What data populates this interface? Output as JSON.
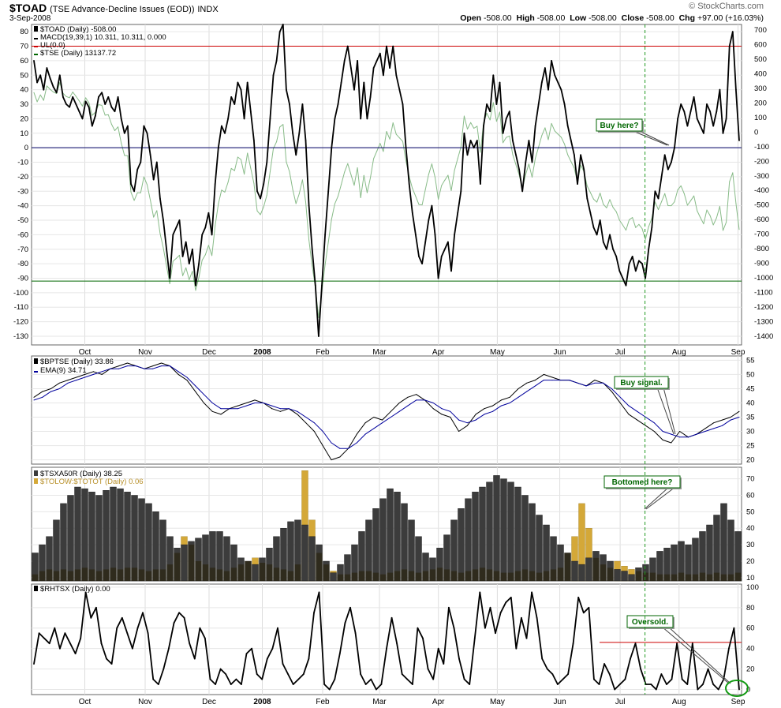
{
  "header": {
    "symbol": "$TOAD",
    "description": "(TSE Advance-Decline Issues (EOD))",
    "exchange": "INDX",
    "date": "3-Sep-2008",
    "open_label": "Open",
    "open_value": "-508.00",
    "high_label": "High",
    "high_value": "-508.00",
    "low_label": "Low",
    "low_value": "-508.00",
    "close_label": "Close",
    "close_value": "-508.00",
    "chg_label": "Chg",
    "chg_value": "+97.00 (+16.03%)",
    "logo": "© StockCharts.com"
  },
  "colors": {
    "black": "#000000",
    "red": "#cc0000",
    "navy": "#000066",
    "green": "#006600",
    "light_green": "#88bb88",
    "blue": "#00009c",
    "gold": "#d4a838",
    "dark_bar": "#3c3c3c"
  },
  "x_axis": {
    "months": [
      "Oct",
      "Nov",
      "Dec",
      "2008",
      "Feb",
      "Mar",
      "Apr",
      "May",
      "Jun",
      "Jul",
      "Aug",
      "Sep"
    ]
  },
  "chart_data": [
    {
      "type": "line",
      "panel": "top",
      "legend": [
        "$TOAD (Daily) -508.00",
        "MACD(19,39,1) 10.311, 10.311, 0.000",
        "UL(0.0)",
        "$TSE (Daily) 13137.72"
      ],
      "series_names": [
        "$TOAD",
        "$TSE"
      ],
      "left_axis": {
        "min": -130,
        "max": 80,
        "ticks": [
          80,
          70,
          60,
          50,
          40,
          30,
          20,
          10,
          0,
          -10,
          -20,
          -30,
          -40,
          -50,
          -60,
          -70,
          -80,
          -90,
          -100,
          -110,
          -120,
          -130
        ]
      },
      "right_axis": {
        "ticks": [
          700,
          600,
          500,
          400,
          300,
          200,
          100,
          0,
          -100,
          -200,
          -300,
          -400,
          -500,
          -600,
          -700,
          -800,
          -900,
          -1000,
          -1100,
          -1200,
          -1300,
          -1400
        ]
      },
      "hlines": [
        70,
        0,
        -92
      ],
      "annotation": "Buy here?",
      "macd": [
        60,
        45,
        50,
        40,
        55,
        48,
        42,
        38,
        50,
        35,
        30,
        28,
        35,
        30,
        25,
        20,
        32,
        28,
        15,
        22,
        35,
        38,
        30,
        35,
        28,
        25,
        35,
        20,
        10,
        15,
        -25,
        -30,
        -15,
        -10,
        15,
        10,
        -5,
        -22,
        -10,
        -35,
        -50,
        -70,
        -90,
        -60,
        -55,
        -50,
        -75,
        -65,
        -80,
        -70,
        -95,
        -80,
        -60,
        -55,
        -45,
        -60,
        -25,
        0,
        15,
        10,
        20,
        35,
        30,
        45,
        40,
        20,
        45,
        25,
        5,
        -30,
        -35,
        -25,
        -10,
        20,
        50,
        60,
        80,
        85,
        40,
        30,
        10,
        -5,
        10,
        30,
        5,
        -40,
        -70,
        -95,
        -130,
        -95,
        -60,
        -30,
        0,
        20,
        30,
        45,
        60,
        70,
        55,
        40,
        60,
        20,
        45,
        20,
        35,
        55,
        60,
        65,
        50,
        70,
        55,
        70,
        50,
        40,
        30,
        0,
        -25,
        -45,
        -60,
        -75,
        -80,
        -65,
        -50,
        -40,
        -60,
        -90,
        -75,
        -70,
        -65,
        -85,
        -60,
        -45,
        -30,
        10,
        -5,
        5,
        0,
        5,
        -25,
        15,
        30,
        25,
        50,
        30,
        45,
        10,
        20,
        25,
        5,
        -5,
        -15,
        -30,
        -10,
        5,
        -10,
        15,
        30,
        45,
        55,
        40,
        60,
        50,
        45,
        40,
        30,
        15,
        5,
        -5,
        -25,
        -5,
        -15,
        -35,
        -45,
        -55,
        -60,
        -50,
        -65,
        -70,
        -60,
        -70,
        -75,
        -85,
        -90,
        -95,
        -80,
        -75,
        -85,
        -78,
        -80,
        -90,
        -70,
        -55,
        -30,
        -35,
        -20,
        -5,
        -15,
        -10,
        0,
        20,
        30,
        25,
        15,
        25,
        35,
        20,
        15,
        10,
        30,
        25,
        15,
        25,
        40,
        10,
        20,
        70,
        80,
        40,
        5
      ]
    },
    {
      "type": "line",
      "panel": "middle",
      "legend": [
        "$BPTSE (Daily) 33.86",
        "EMA(9) 34.71"
      ],
      "series_names": [
        "$BPTSE",
        "EMA(9)"
      ],
      "y_axis": {
        "min": 20,
        "max": 55,
        "ticks": [
          55,
          50,
          45,
          40,
          35,
          30,
          25,
          20
        ]
      },
      "annotation": "Buy signal.",
      "bptse": [
        42,
        44,
        45,
        47,
        48,
        49,
        50,
        51,
        50,
        52,
        53,
        54,
        53,
        52,
        53,
        54,
        53,
        50,
        48,
        44,
        40,
        37,
        36,
        38,
        39,
        40,
        41,
        40,
        38,
        37,
        38,
        36,
        33,
        30,
        25,
        20,
        21,
        24,
        29,
        33,
        35,
        34,
        37,
        40,
        42,
        43,
        41,
        38,
        36,
        35,
        30,
        32,
        36,
        38,
        39,
        41,
        42,
        45,
        47,
        48,
        50,
        49,
        48,
        48,
        47,
        46,
        48,
        47,
        44,
        40,
        36,
        34,
        32,
        30,
        27,
        26,
        30,
        28,
        29,
        31,
        33,
        34,
        35,
        37
      ],
      "ema": [
        41,
        42,
        44,
        45,
        47,
        48,
        49,
        50,
        51,
        52,
        52,
        53,
        53,
        52,
        52,
        53,
        53,
        51,
        49,
        46,
        43,
        40,
        38,
        38,
        38,
        39,
        40,
        40,
        39,
        38,
        38,
        37,
        35,
        33,
        30,
        26,
        24,
        24,
        26,
        29,
        31,
        33,
        35,
        37,
        39,
        41,
        41,
        40,
        38,
        37,
        34,
        33,
        34,
        36,
        37,
        39,
        40,
        42,
        44,
        46,
        48,
        48,
        48,
        48,
        47,
        46,
        47,
        47,
        45,
        42,
        39,
        37,
        35,
        33,
        30,
        29,
        28,
        28,
        29,
        30,
        31,
        32,
        34,
        35
      ]
    },
    {
      "type": "bar",
      "panel": "lower",
      "legend": [
        "$TSXA50R (Daily) 38.25",
        "$TOLOW:$TOTOT (Daily) 0.06"
      ],
      "series_names": [
        "$TSXA50R",
        "$TOLOW:$TOTOT"
      ],
      "y_axis": {
        "min": 10,
        "max": 75,
        "ticks": [
          70,
          60,
          50,
          40,
          30,
          20,
          10
        ]
      },
      "annotation": "Bottomed here?",
      "dark": [
        25,
        30,
        35,
        45,
        55,
        60,
        65,
        64,
        62,
        60,
        63,
        65,
        64,
        62,
        60,
        58,
        55,
        50,
        45,
        35,
        28,
        30,
        32,
        34,
        36,
        38,
        38,
        35,
        30,
        22,
        20,
        18,
        22,
        28,
        35,
        40,
        44,
        45,
        42,
        35,
        30,
        20,
        13,
        18,
        24,
        30,
        38,
        45,
        52,
        58,
        64,
        62,
        55,
        45,
        35,
        25,
        22,
        28,
        36,
        45,
        52,
        58,
        62,
        65,
        68,
        72,
        70,
        68,
        65,
        60,
        55,
        48,
        42,
        35,
        30,
        25,
        20,
        18,
        22,
        26,
        24,
        20,
        15,
        14,
        12,
        16,
        18,
        22,
        26,
        28,
        30,
        32,
        30,
        34,
        38,
        42,
        48,
        55,
        45,
        38
      ],
      "gold": [
        12,
        14,
        15,
        14,
        15,
        14,
        15,
        16,
        15,
        14,
        15,
        16,
        15,
        16,
        16,
        15,
        14,
        15,
        15,
        18,
        25,
        35,
        30,
        20,
        18,
        16,
        15,
        14,
        16,
        18,
        20,
        22,
        19,
        18,
        16,
        15,
        14,
        18,
        75,
        45,
        25,
        18,
        14,
        12,
        12,
        13,
        14,
        14,
        13,
        12,
        13,
        14,
        15,
        14,
        13,
        14,
        15,
        16,
        15,
        14,
        13,
        14,
        15,
        16,
        15,
        14,
        13,
        13,
        14,
        15,
        14,
        13,
        14,
        15,
        16,
        25,
        35,
        55,
        40,
        22,
        18,
        16,
        20,
        17,
        15,
        14,
        13,
        13,
        12,
        12,
        12,
        13,
        12,
        12,
        13,
        12,
        13,
        12,
        12,
        13
      ]
    },
    {
      "type": "line",
      "panel": "bottom",
      "legend": [
        "$RHTSX (Daily) 0.00"
      ],
      "series_names": [
        "$RHTSX"
      ],
      "y_axis": {
        "min": 0,
        "max": 100,
        "ticks": [
          100,
          80,
          60,
          40,
          20,
          0
        ]
      },
      "hline": 46,
      "annotation": "Oversold.",
      "rhtsx": [
        25,
        55,
        50,
        45,
        60,
        40,
        55,
        45,
        35,
        50,
        95,
        70,
        80,
        45,
        30,
        25,
        60,
        70,
        55,
        40,
        60,
        75,
        55,
        10,
        5,
        20,
        40,
        65,
        75,
        70,
        45,
        30,
        60,
        50,
        10,
        5,
        20,
        15,
        5,
        10,
        5,
        35,
        40,
        15,
        10,
        30,
        40,
        60,
        25,
        15,
        5,
        10,
        15,
        30,
        75,
        95,
        5,
        0,
        10,
        35,
        65,
        80,
        55,
        15,
        5,
        10,
        0,
        5,
        40,
        70,
        45,
        15,
        10,
        5,
        60,
        50,
        20,
        10,
        40,
        25,
        80,
        60,
        30,
        10,
        5,
        50,
        95,
        60,
        80,
        55,
        75,
        85,
        90,
        40,
        70,
        50,
        95,
        70,
        30,
        20,
        15,
        5,
        10,
        15,
        45,
        90,
        75,
        80,
        10,
        5,
        25,
        15,
        0,
        5,
        10,
        30,
        45,
        20,
        5,
        5,
        0,
        15,
        5,
        10,
        45,
        10,
        5,
        45,
        0,
        5,
        20,
        5,
        0,
        10,
        40,
        60,
        0
      ]
    }
  ]
}
